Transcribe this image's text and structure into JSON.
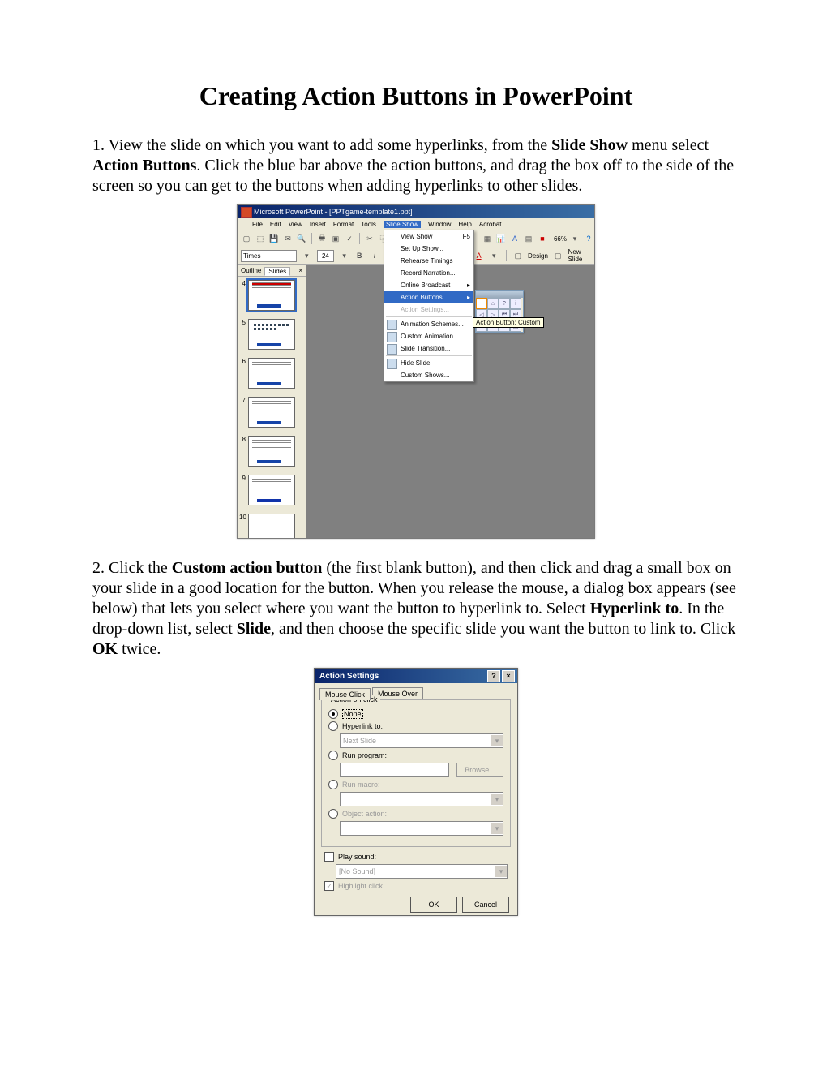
{
  "title": "Creating Action Buttons in PowerPoint",
  "para1": {
    "t1": "1. View the slide on which you want to add some hyperlinks, from the ",
    "b1": "Slide Show",
    "t2": " menu select ",
    "b2": "Action Buttons",
    "t3": ". Click the blue bar above the action buttons, and drag the box off to the side of the screen so you can get to the buttons when adding hyperlinks to other slides."
  },
  "shot1": {
    "title": "Microsoft PowerPoint - [PPTgame-template1.ppt]",
    "menus": [
      "File",
      "Edit",
      "View",
      "Insert",
      "Format",
      "Tools",
      "Slide Show",
      "Window",
      "Help",
      "Acrobat"
    ],
    "highlighted_menu_index": 6,
    "font": "Times",
    "fontsize": "24",
    "zoom": "66%",
    "right_labels": [
      "Design",
      "New Slide"
    ],
    "tabs": {
      "outline": "Outline",
      "slides": "Slides"
    },
    "thumb_numbers": [
      "4",
      "5",
      "6",
      "7",
      "8",
      "9",
      "10"
    ],
    "dropdown": [
      {
        "label": "View Show",
        "accel": "F5"
      },
      {
        "label": "Set Up Show..."
      },
      {
        "label": "Rehearse Timings"
      },
      {
        "label": "Record Narration..."
      },
      {
        "label": "Online Broadcast",
        "arrow": true
      },
      {
        "label": "Action Buttons",
        "arrow": true,
        "hl": true
      },
      {
        "label": "Action Settings...",
        "dis": true
      },
      {
        "label": "Animation Schemes...",
        "icon": true
      },
      {
        "label": "Custom Animation...",
        "icon": true
      },
      {
        "label": "Slide Transition...",
        "icon": true
      },
      {
        "label": "Hide Slide",
        "icon": true
      },
      {
        "label": "Custom Shows..."
      }
    ],
    "tooltip": "Action Button: Custom"
  },
  "para2": {
    "t1": "2. Click the ",
    "b1": "Custom action button",
    "t2": " (the first blank button), and then click and drag a small box on your slide in a good location for the button. When you release the mouse, a dialog box appears (see below) that lets you select where you want the button to hyperlink to. Select ",
    "b2": "Hyperlink to",
    "t3": ". In the drop-down list, select ",
    "b3": "Slide",
    "t4": ", and then choose the specific slide you want the button to link to. Click ",
    "b4": "OK",
    "t5": " twice."
  },
  "shot2": {
    "title": "Action Settings",
    "tabs": [
      "Mouse Click",
      "Mouse Over"
    ],
    "legend": "Action on click",
    "opt_none": "None",
    "opt_hyper": "Hyperlink to:",
    "hyper_val": "Next Slide",
    "opt_run": "Run program:",
    "browse": "Browse...",
    "opt_macro": "Run macro:",
    "opt_obj": "Object action:",
    "play": "Play sound:",
    "sound_val": "[No Sound]",
    "highlight": "Highlight click",
    "ok": "OK",
    "cancel": "Cancel"
  }
}
